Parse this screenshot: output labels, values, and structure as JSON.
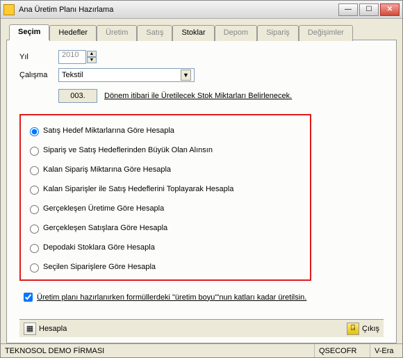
{
  "window": {
    "title": "Ana Üretim Planı Hazırlama"
  },
  "tabs": [
    "Seçim",
    "Hedefler",
    "Üretim",
    "Satış",
    "Stoklar",
    "Depom",
    "Sipariş",
    "Değişimler"
  ],
  "form": {
    "year_label": "Yıl",
    "year_value": "2010",
    "work_label": "Çalışma",
    "work_value": "Tekstil",
    "work_options": [
      "Tekstil"
    ],
    "code_value": "003.",
    "desc": "Dönem itibari ile Üretilecek Stok Miktarları Belirlenecek."
  },
  "options": [
    {
      "label": "Satış Hedef Miktarlarına Göre Hesapla",
      "selected": true
    },
    {
      "label": "Sipariş ve Satış Hedeflerinden Büyük Olan Alınsın",
      "selected": false
    },
    {
      "label": "Kalan Sipariş Miktarına Göre Hesapla",
      "selected": false
    },
    {
      "label": "Kalan Siparişler ile Satış Hedeflerini Toplayarak Hesapla",
      "selected": false
    },
    {
      "label": "Gerçekleşen Üretime Göre Hesapla",
      "selected": false
    },
    {
      "label": "Gerçekleşen Satışlara Göre Hesapla",
      "selected": false
    },
    {
      "label": "Depodaki Stoklara Göre Hesapla",
      "selected": false
    },
    {
      "label": "Seçilen Siparişlere Göre Hesapla",
      "selected": false
    }
  ],
  "checkbox": {
    "checked": true,
    "label": "Üretim planı hazırlanırken formüllerdeki \"üretim boyu\"'nun katları kadar üretilsin."
  },
  "buttons": {
    "calc": "Hesapla",
    "exit": "Çıkış"
  },
  "status": {
    "company": "TEKNOSOL DEMO FİRMASI",
    "user": "QSECOFR",
    "ver": "V-Era"
  }
}
